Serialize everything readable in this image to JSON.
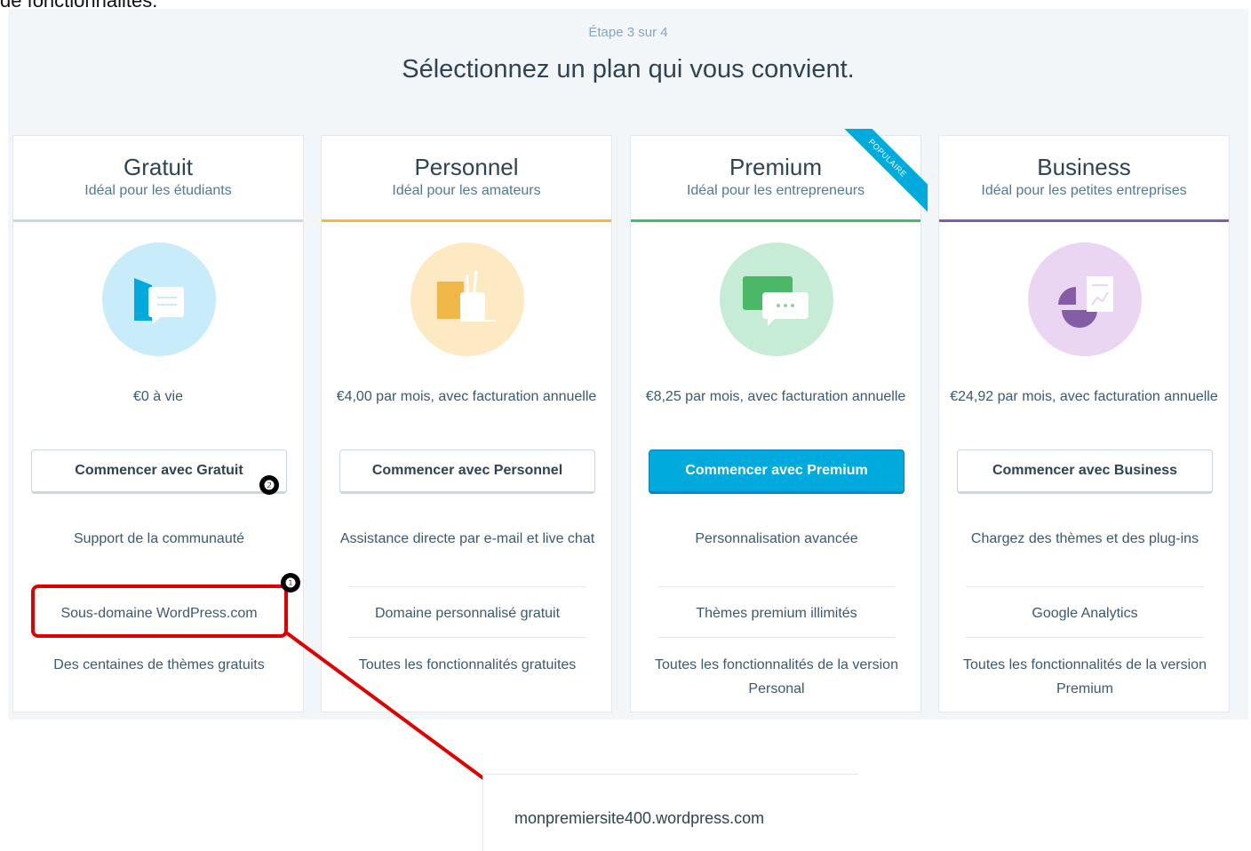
{
  "top_caption": "de fonctionnalités.",
  "header": {
    "step": "Étape 3 sur 4",
    "title": "Sélectionnez un plan qui vous convient."
  },
  "plans": [
    {
      "name": "Gratuit",
      "subtitle": "Idéal pour les étudiants",
      "accent": "#c8d7e1",
      "circle_color": "#c9ecfa",
      "price": "€0 à vie",
      "button": "Commencer avec Gratuit",
      "features": [
        "Support de la communauté",
        "Sous-domaine WordPress.com",
        "Des centaines de thèmes gratuits"
      ]
    },
    {
      "name": "Personnel",
      "subtitle": "Idéal pour les amateurs",
      "accent": "#f0b849",
      "circle_color": "#fde9c2",
      "price": "€4,00 par mois, avec facturation annuelle",
      "button": "Commencer avec Personnel",
      "features": [
        "Assistance directe par e-mail et live chat",
        "Domaine personnalisé gratuit",
        "Toutes les fonctionnalités gratuites"
      ]
    },
    {
      "name": "Premium",
      "subtitle": "Idéal pour les entrepreneurs",
      "accent": "#4ab866",
      "circle_color": "#c7ecd6",
      "price": "€8,25 par mois, avec facturation annuelle",
      "button": "Commencer avec Premium",
      "ribbon": "POPULAIRE",
      "features": [
        "Personnalisation avancée",
        "Thèmes premium illimités",
        "Toutes les fonctionnalités de la version Personal"
      ]
    },
    {
      "name": "Business",
      "subtitle": "Idéal pour les petites entreprises",
      "accent": "#855da6",
      "circle_color": "#ead5f2",
      "price": "€24,92 par mois, avec facturation annuelle",
      "button": "Commencer avec Business",
      "features": [
        "Chargez des thèmes et des plug-ins",
        "Google Analytics",
        "Toutes les fonctionnalités de la version Premium"
      ]
    }
  ],
  "annotations": {
    "badge_1": "❶",
    "badge_2": "❷",
    "highlight_color": "#e00000"
  },
  "subdomain_preview": "monpremiersite400.wordpress.com"
}
